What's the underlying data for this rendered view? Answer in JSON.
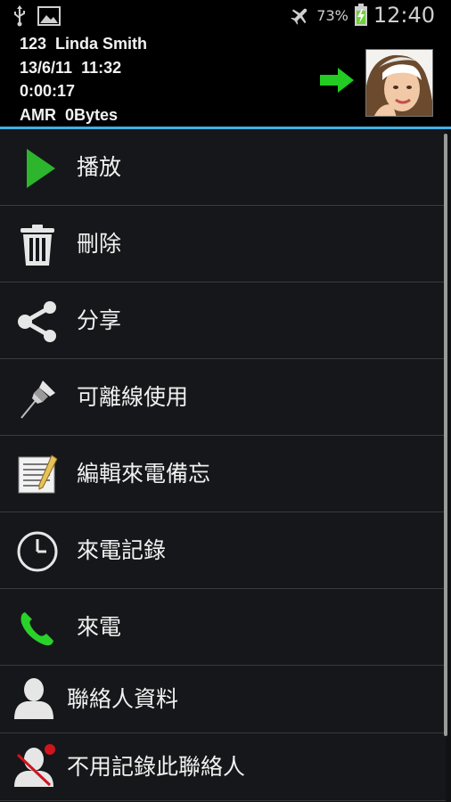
{
  "status_bar": {
    "battery_percent": "73%",
    "time": "12:40",
    "icons": [
      "usb-icon",
      "image-icon",
      "airplane-mode-icon",
      "battery-charging-icon"
    ]
  },
  "header": {
    "line1": "123  Linda Smith",
    "line2": "13/6/11  11:32",
    "line3": "0:00:17",
    "line4": "AMR  0Bytes"
  },
  "menu": {
    "items": [
      {
        "label": "播放",
        "icon": "play-icon"
      },
      {
        "label": "刪除",
        "icon": "trash-icon"
      },
      {
        "label": "分享",
        "icon": "share-icon"
      },
      {
        "label": "可離線使用",
        "icon": "pushpin-icon"
      },
      {
        "label": "編輯來電備忘",
        "icon": "notepad-icon"
      },
      {
        "label": "來電記錄",
        "icon": "clock-icon"
      },
      {
        "label": "來電",
        "icon": "phone-icon"
      },
      {
        "label": "聯絡人資料",
        "icon": "contact-icon"
      },
      {
        "label": "不用記錄此聯絡人",
        "icon": "contact-block-icon"
      }
    ]
  },
  "colors": {
    "accent_rule": "#3fb0e6",
    "play_green": "#2db52d",
    "phone_green": "#2ad12a",
    "arrow_green": "#22cc22",
    "block_red": "#d0141e"
  }
}
